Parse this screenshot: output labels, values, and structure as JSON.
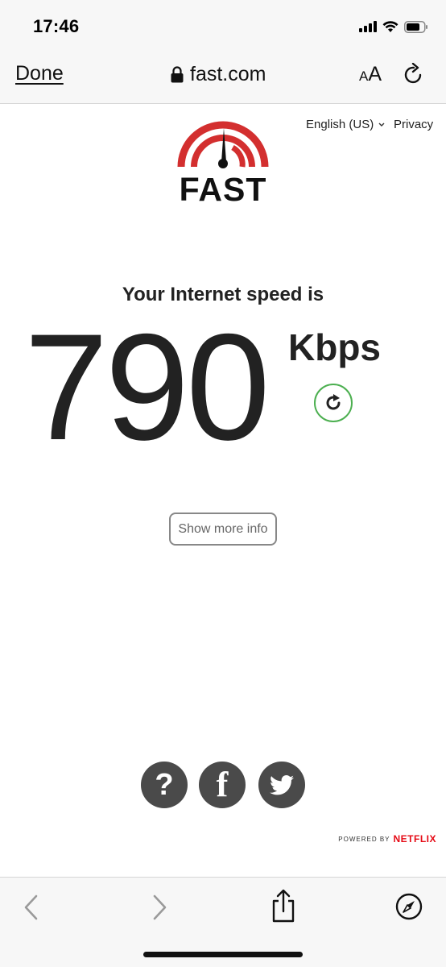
{
  "status_bar": {
    "time": "17:46",
    "icons": [
      "cellular-signal-icon",
      "wifi-icon",
      "battery-icon"
    ]
  },
  "browser": {
    "done_label": "Done",
    "address": "fast.com",
    "text_size_small": "A",
    "text_size_large": "A",
    "icons": [
      "lock-icon",
      "reload-icon",
      "back-icon",
      "forward-icon",
      "share-icon",
      "compass-icon"
    ]
  },
  "page": {
    "language": "English (US)",
    "privacy_label": "Privacy",
    "logo_text": "FAST",
    "caption": "Your Internet speed is",
    "speed": "790",
    "units": "Kbps",
    "more_info_label": "Show more info",
    "powered_by": "POWERED BY",
    "netflix": "NETFLIX",
    "social_icons": [
      "help-icon",
      "facebook-icon",
      "twitter-icon"
    ]
  },
  "colors": {
    "logo_red": "#d32f2f",
    "refresh_green": "#4caf50",
    "netflix_red": "#e50914",
    "social_grey": "#4a4a4a"
  }
}
